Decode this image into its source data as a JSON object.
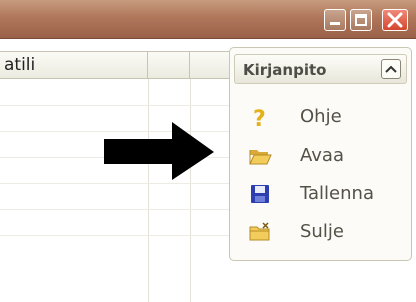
{
  "window": {
    "buttons": [
      {
        "name": "minimize-icon"
      },
      {
        "name": "maximize-icon"
      },
      {
        "name": "close-icon"
      }
    ]
  },
  "grid": {
    "columns": [
      "atili",
      "",
      ""
    ]
  },
  "task_pane": {
    "title": "Kirjanpito",
    "items": [
      {
        "label": "Ohje",
        "icon": "help-icon",
        "color": "#e5b11a"
      },
      {
        "label": "Avaa",
        "icon": "open-folder-icon",
        "color": "#e9c14a"
      },
      {
        "label": "Tallenna",
        "icon": "save-disk-icon",
        "color": "#2d3fb0"
      },
      {
        "label": "Sulje",
        "icon": "close-folder-icon",
        "color": "#e9c14a"
      }
    ]
  },
  "colors": {
    "titlebar": "#b0775b",
    "close_button": "#d4462c",
    "pane_border": "#c9c6b2"
  }
}
